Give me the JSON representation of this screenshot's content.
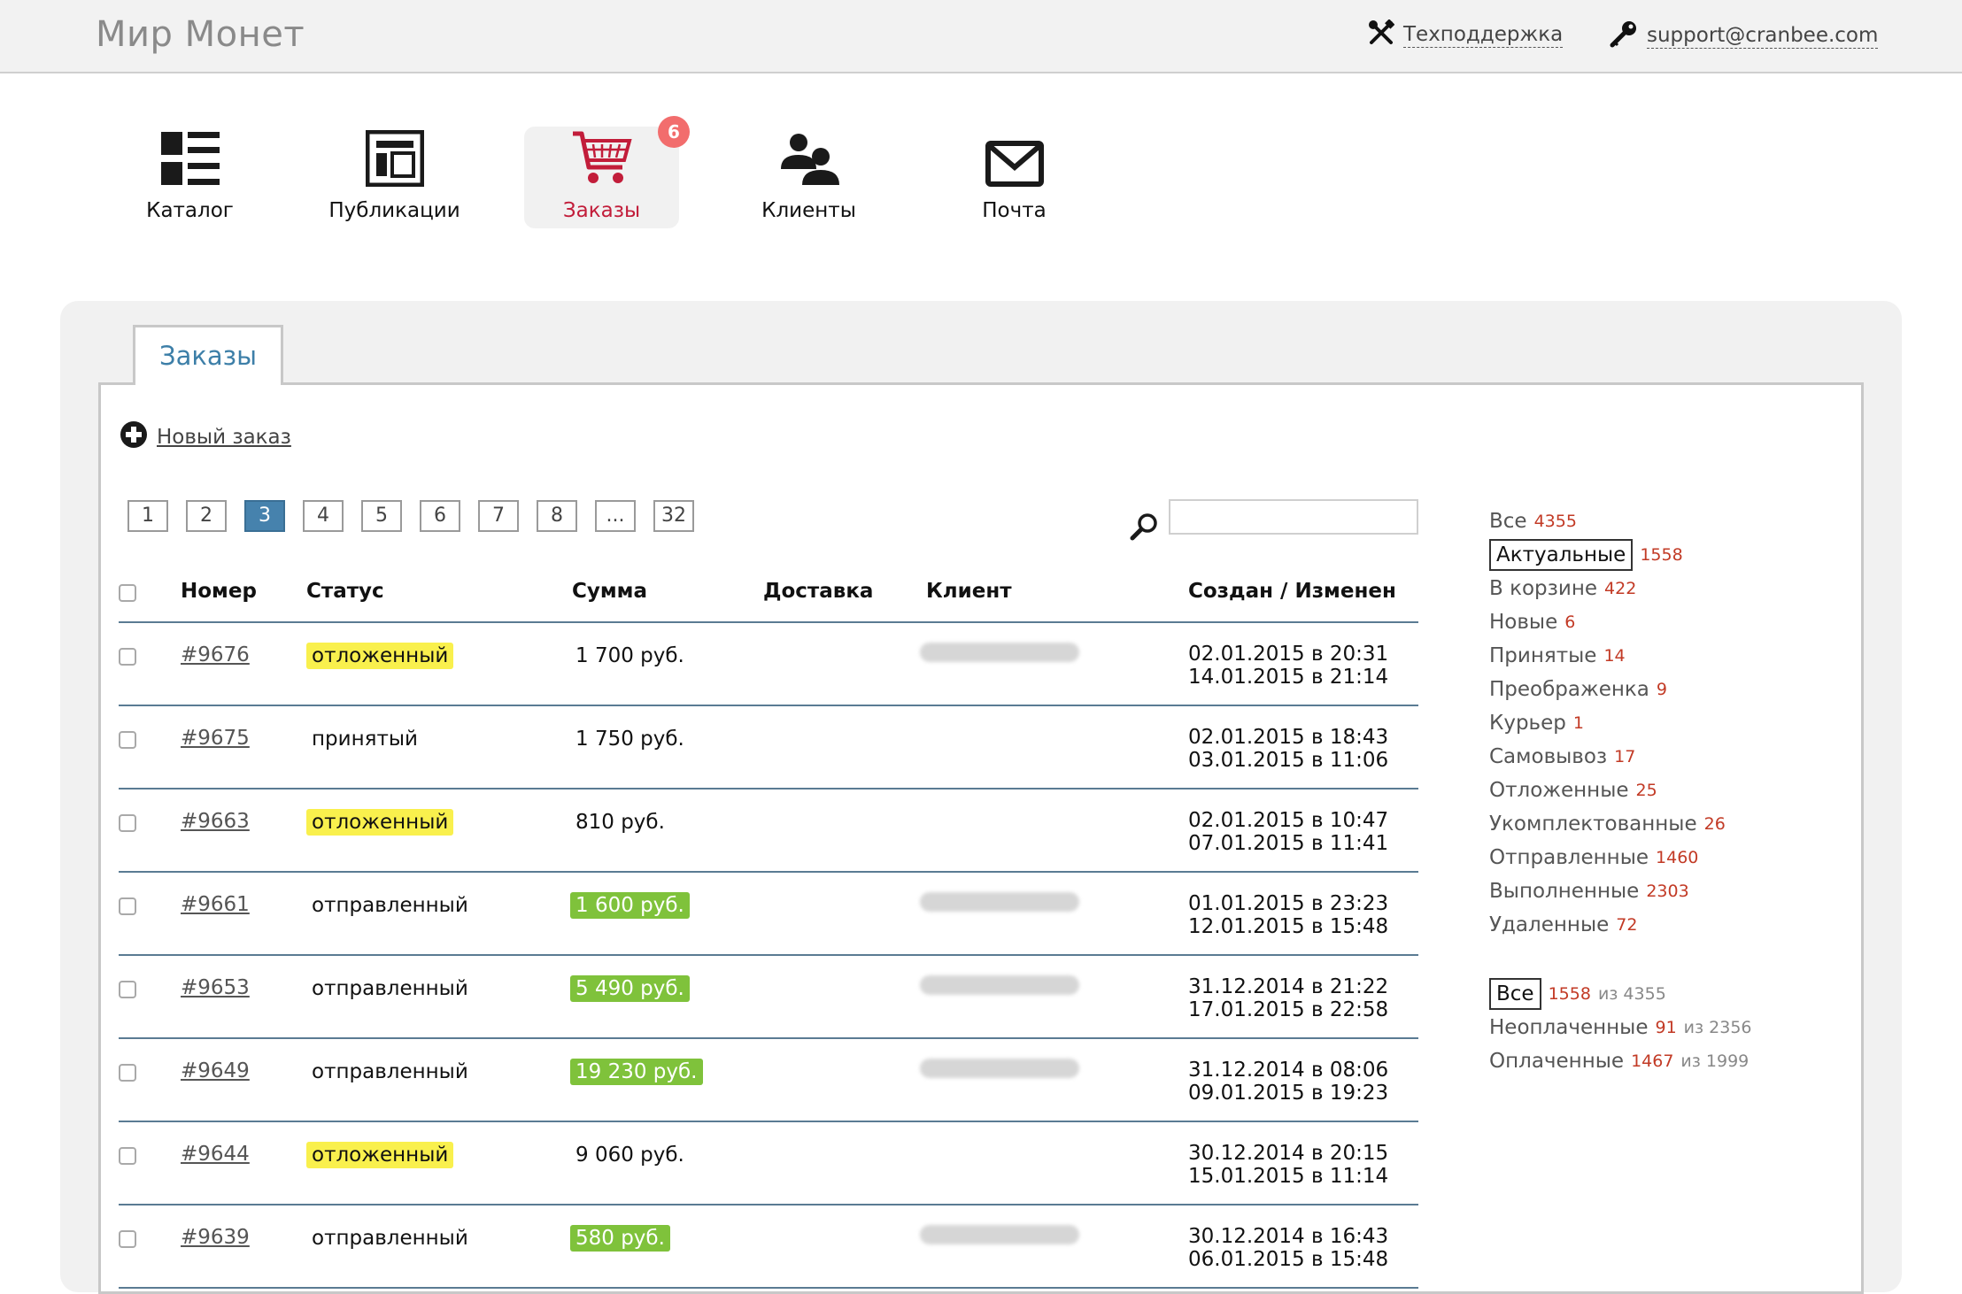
{
  "brand": "Мир Монет",
  "topbar": {
    "support_label": "Техподдержка",
    "email": "support@cranbee.com"
  },
  "nav": [
    {
      "label": "Каталог",
      "icon": "catalog-list-icon"
    },
    {
      "label": "Публикации",
      "icon": "layout-icon"
    },
    {
      "label": "Заказы",
      "icon": "cart-icon",
      "badge": "6",
      "active": true
    },
    {
      "label": "Клиенты",
      "icon": "users-icon"
    },
    {
      "label": "Почта",
      "icon": "envelope-icon"
    }
  ],
  "tab_title": "Заказы",
  "new_order": "Новый заказ",
  "pager": [
    "1",
    "2",
    "3",
    "4",
    "5",
    "6",
    "7",
    "8",
    "...",
    "32"
  ],
  "pager_active": "3",
  "columns": {
    "number": "Номер",
    "status": "Статус",
    "sum": "Сумма",
    "delivery": "Доставка",
    "client": "Клиент",
    "dates": "Создан / Изменен"
  },
  "orders": [
    {
      "number": "#9676",
      "status": "отложенный",
      "status_hl": true,
      "sum": "1 700 руб.",
      "sum_hl": false,
      "client_hidden": true,
      "created": "02.01.2015 в 20:31",
      "modified": "14.01.2015 в 21:14"
    },
    {
      "number": "#9675",
      "status": "принятый",
      "status_hl": false,
      "sum": "1 750 руб.",
      "sum_hl": false,
      "client_hidden": false,
      "created": "02.01.2015 в 18:43",
      "modified": "03.01.2015 в 11:06"
    },
    {
      "number": "#9663",
      "status": "отложенный",
      "status_hl": true,
      "sum": "810 руб.",
      "sum_hl": false,
      "client_hidden": false,
      "created": "02.01.2015 в 10:47",
      "modified": "07.01.2015 в 11:41"
    },
    {
      "number": "#9661",
      "status": "отправленный",
      "status_hl": false,
      "sum": "1 600 руб.",
      "sum_hl": true,
      "client_hidden": true,
      "created": "01.01.2015 в 23:23",
      "modified": "12.01.2015 в 15:48"
    },
    {
      "number": "#9653",
      "status": "отправленный",
      "status_hl": false,
      "sum": "5 490 руб.",
      "sum_hl": true,
      "client_hidden": true,
      "created": "31.12.2014 в 21:22",
      "modified": "17.01.2015 в 22:58"
    },
    {
      "number": "#9649",
      "status": "отправленный",
      "status_hl": false,
      "sum": "19 230 руб.",
      "sum_hl": true,
      "client_hidden": true,
      "created": "31.12.2014 в 08:06",
      "modified": "09.01.2015 в 19:23"
    },
    {
      "number": "#9644",
      "status": "отложенный",
      "status_hl": true,
      "sum": "9 060 руб.",
      "sum_hl": false,
      "client_hidden": false,
      "created": "30.12.2014 в 20:15",
      "modified": "15.01.2015 в 11:14"
    },
    {
      "number": "#9639",
      "status": "отправленный",
      "status_hl": false,
      "sum": "580 руб.",
      "sum_hl": true,
      "client_hidden": true,
      "created": "30.12.2014 в 16:43",
      "modified": "06.01.2015 в 15:48"
    }
  ],
  "filters_status": [
    {
      "label": "Все",
      "count": "4355"
    },
    {
      "label": "Актуальные",
      "count": "1558",
      "selected": true
    },
    {
      "label": "В корзине",
      "count": "422"
    },
    {
      "label": "Новые",
      "count": "6"
    },
    {
      "label": "Принятые",
      "count": "14"
    },
    {
      "label": "Преображенка",
      "count": "9"
    },
    {
      "label": "Курьер",
      "count": "1"
    },
    {
      "label": "Самовывоз",
      "count": "17"
    },
    {
      "label": "Отложенные",
      "count": "25"
    },
    {
      "label": "Укомплектованные",
      "count": "26"
    },
    {
      "label": "Отправленные",
      "count": "1460"
    },
    {
      "label": "Выполненные",
      "count": "2303"
    },
    {
      "label": "Удаленные",
      "count": "72"
    }
  ],
  "filters_payment": [
    {
      "label": "Все",
      "count": "1558",
      "of": "из 4355",
      "selected": true
    },
    {
      "label": "Неоплаченные",
      "count": "91",
      "of": "из 2356"
    },
    {
      "label": "Оплаченные",
      "count": "1467",
      "of": "из 1999"
    }
  ],
  "colors": {
    "accent": "#4682ad",
    "active_nav": "#c21d3a",
    "badge": "#f26d6d",
    "status_highlight": "#f9f04d",
    "sum_highlight": "#7fc23b",
    "count_text": "#c23a25"
  }
}
